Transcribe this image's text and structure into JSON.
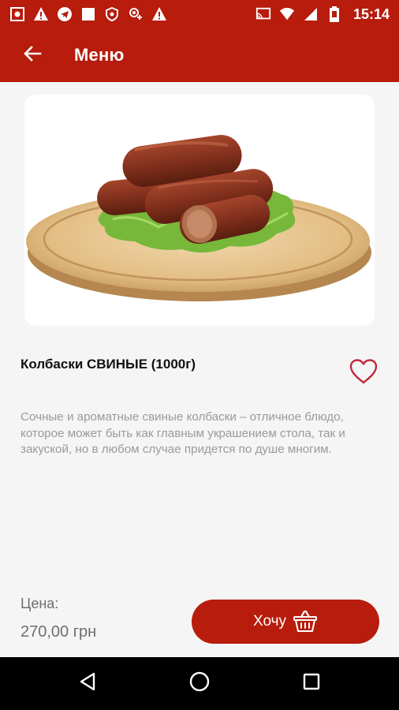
{
  "status_bar": {
    "time": "15:14",
    "left_icons": [
      "screenshot-icon",
      "warning-icon",
      "telegram-icon",
      "square-icon",
      "shield-icon",
      "cast-users-icon",
      "warning-icon"
    ],
    "right_icons": [
      "cast-icon",
      "wifi-icon",
      "signal-icon",
      "battery-icon"
    ]
  },
  "app_bar": {
    "title": "Меню",
    "back_icon": "arrow-left-icon"
  },
  "product": {
    "name": "Колбаски СВИНЫЕ (1000г)",
    "description": "Сочные и ароматные свиные колбаски – отличное блюдо, которое может быть как главным украшением стола, так и закуской, но в любом случае придется по душе многим.",
    "favorite_icon": "heart-outline-icon"
  },
  "price": {
    "label": "Цена:",
    "value": "270,00 грн"
  },
  "cta": {
    "label": "Хочу",
    "icon": "basket-icon"
  },
  "nav_bar": {
    "icons": [
      "back-triangle-icon",
      "home-circle-icon",
      "recents-square-icon"
    ]
  },
  "colors": {
    "brand": "#b71c0c",
    "background": "#f5f5f5",
    "description_text": "#9a9a9a",
    "price_text": "#6e6e6e"
  }
}
